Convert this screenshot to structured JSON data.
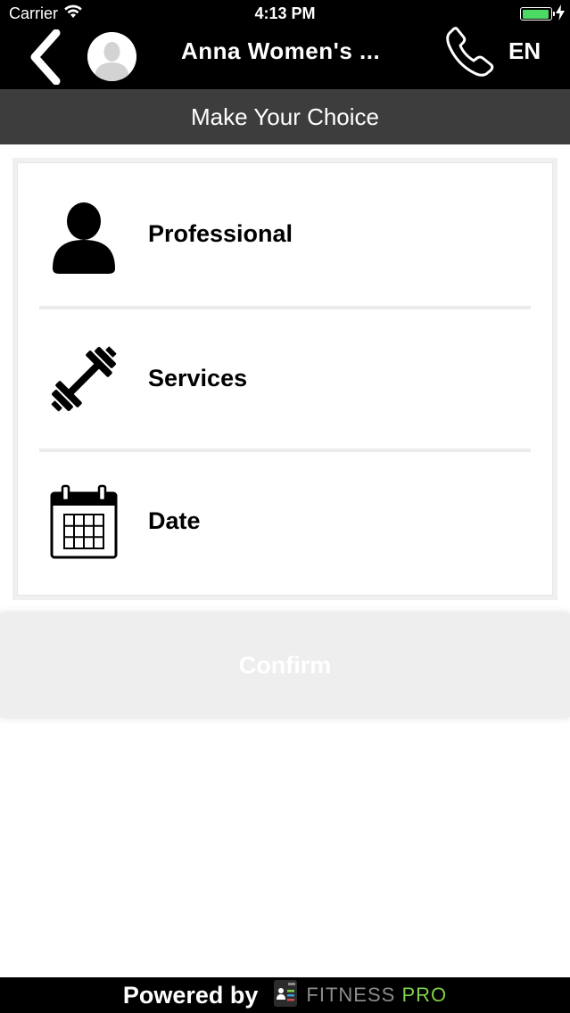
{
  "status_bar": {
    "carrier": "Carrier",
    "time": "4:13 PM",
    "battery_level": 0.95,
    "battery_color": "#4cd964"
  },
  "header": {
    "title": "Anna Women's ...",
    "language": "EN",
    "back_icon": "chevron-left-icon",
    "avatar_icon": "user-avatar-icon",
    "phone_icon": "phone-icon"
  },
  "subheader": {
    "title": "Make Your Choice"
  },
  "choices": [
    {
      "label": "Professional",
      "icon": "person-icon"
    },
    {
      "label": "Services",
      "icon": "dumbbell-icon"
    },
    {
      "label": "Date",
      "icon": "calendar-icon"
    }
  ],
  "confirm": {
    "label": "Confirm"
  },
  "footer": {
    "powered_by": "Powered by",
    "brand_part1": "FITNESS",
    "brand_part2": "PRO",
    "brand_colors": [
      "#8c8c8c",
      "#7fd14a"
    ]
  }
}
